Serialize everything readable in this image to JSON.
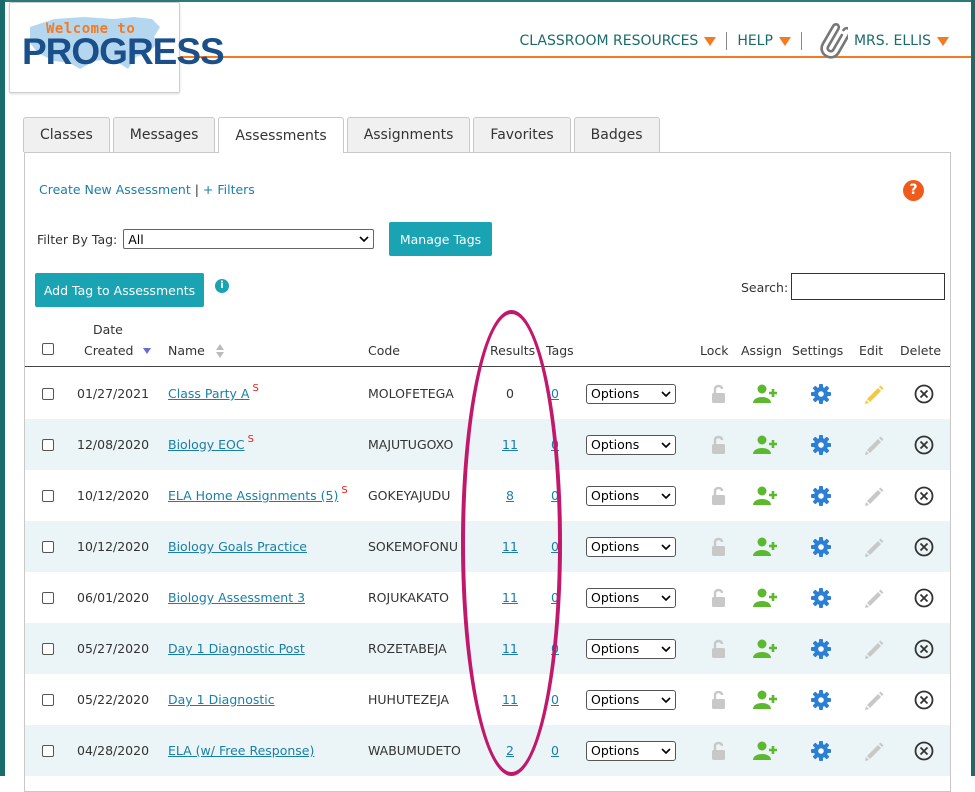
{
  "logo": {
    "welcome": "Welcome to",
    "progress": "PROGRESS"
  },
  "topnav": {
    "resources": "CLASSROOM RESOURCES",
    "help": "HELP",
    "user": "MRS. ELLIS"
  },
  "tabs": [
    {
      "label": "Classes"
    },
    {
      "label": "Messages"
    },
    {
      "label": "Assessments"
    },
    {
      "label": "Assignments"
    },
    {
      "label": "Favorites"
    },
    {
      "label": "Badges"
    }
  ],
  "actions": {
    "create": "Create New Assessment",
    "sep": " | ",
    "filters": "+ Filters",
    "help_icon": "?"
  },
  "filter": {
    "label": "Filter By Tag:",
    "value": "All"
  },
  "buttons": {
    "manage_tags": "Manage Tags",
    "add_tag": "Add Tag to Assessments",
    "info": "i"
  },
  "search": {
    "label": "Search:"
  },
  "columns": {
    "date_top": "Date",
    "date_bottom": "Created",
    "name": "Name",
    "code": "Code",
    "results": "Results",
    "tags": "Tags",
    "lock": "Lock",
    "assign": "Assign",
    "settings": "Settings",
    "edit": "Edit",
    "delete": "Delete"
  },
  "rows": [
    {
      "date": "01/27/2021",
      "name": "Class Party A",
      "s": "S",
      "code": "MOLOFETEGA",
      "results": "0",
      "results_link": false,
      "tags": "0",
      "option": "Options",
      "edit_active": true
    },
    {
      "date": "12/08/2020",
      "name": "Biology EOC",
      "s": "S",
      "code": "MAJUTUGOXO",
      "results": "11",
      "results_link": true,
      "tags": "0",
      "option": "Options",
      "edit_active": false
    },
    {
      "date": "10/12/2020",
      "name": "ELA Home Assignments (5)",
      "s": "S",
      "code": "GOKEYAJUDU",
      "results": "8",
      "results_link": true,
      "tags": "0",
      "option": "Options",
      "edit_active": false
    },
    {
      "date": "10/12/2020",
      "name": "Biology Goals Practice",
      "s": "",
      "code": "SOKEMOFONU",
      "results": "11",
      "results_link": true,
      "tags": "0",
      "option": "Options",
      "edit_active": false
    },
    {
      "date": "06/01/2020",
      "name": "Biology Assessment 3",
      "s": "",
      "code": "ROJUKAKATO",
      "results": "11",
      "results_link": true,
      "tags": "0",
      "option": "Options",
      "edit_active": false
    },
    {
      "date": "05/27/2020",
      "name": "Day 1 Diagnostic Post",
      "s": "",
      "code": "ROZETABEJA",
      "results": "11",
      "results_link": true,
      "tags": "0",
      "option": "Options",
      "edit_active": false
    },
    {
      "date": "05/22/2020",
      "name": "Day 1 Diagnostic",
      "s": "",
      "code": "HUHUTEZEJA",
      "results": "11",
      "results_link": true,
      "tags": "0",
      "option": "Options",
      "edit_active": false
    },
    {
      "date": "04/28/2020",
      "name": "ELA (w/ Free Response)",
      "s": "",
      "code": "WABUMUDETO",
      "results": "2",
      "results_link": true,
      "tags": "0",
      "option": "Options",
      "edit_active": false
    }
  ],
  "colors": {
    "teal": "#1aa3b3",
    "link": "#1a7fa8",
    "orange": "#f47a20",
    "assign_green": "#5cb82e",
    "gear_blue": "#2b7fd4",
    "edit_yellow": "#f5c842",
    "highlight": "#c2186b",
    "row_alt": "#ebf4f6"
  },
  "icons": {
    "lock": "lock-open-icon",
    "assign": "add-user-icon",
    "settings": "gear-icon",
    "edit": "pencil-icon",
    "delete": "circle-x-icon",
    "help": "question-circle-icon",
    "info": "info-circle-icon"
  }
}
